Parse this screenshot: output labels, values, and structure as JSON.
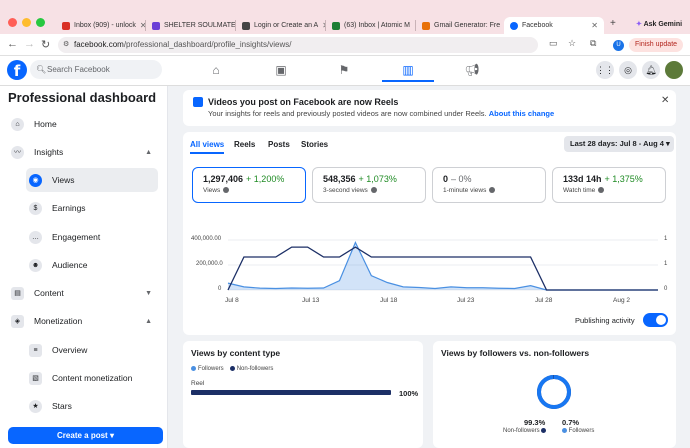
{
  "browser": {
    "tabs": [
      {
        "title": "Inbox (909) - unlock",
        "color": "#d93025"
      },
      {
        "title": "SHELTER SOULMATE",
        "color": "#6b3fd6"
      },
      {
        "title": "Login or Create an A",
        "color": "#444444"
      },
      {
        "title": "(63) Inbox | Atomic M",
        "color": "#1e7e34"
      },
      {
        "title": "Gmail Generator: Fre",
        "color": "#e8710a"
      },
      {
        "title": "Facebook",
        "color": "#0866ff"
      }
    ],
    "ask_gemini": "Ask Gemini",
    "url_host": "facebook.com",
    "url_path": "/professional_dashboard/profile_insights/views/",
    "finish_update": "Finish update",
    "profile_initial": "U"
  },
  "fb": {
    "search_placeholder": "Search Facebook",
    "logo_letter": "f"
  },
  "sidebar": {
    "title": "Professional dashboard",
    "items": [
      {
        "label": "Home",
        "icon": "home-icon"
      },
      {
        "label": "Insights",
        "icon": "insights-icon"
      },
      {
        "label": "Views",
        "icon": "eye-icon"
      },
      {
        "label": "Earnings",
        "icon": "dollar-icon"
      },
      {
        "label": "Engagement",
        "icon": "chat-icon"
      },
      {
        "label": "Audience",
        "icon": "people-icon"
      },
      {
        "label": "Content",
        "icon": "content-icon"
      },
      {
        "label": "Monetization",
        "icon": "monetization-icon"
      },
      {
        "label": "Overview",
        "icon": "overview-icon"
      },
      {
        "label": "Content monetization",
        "icon": "content-monetization-icon"
      },
      {
        "label": "Stars",
        "icon": "stars-icon"
      }
    ],
    "cta": "Create a post"
  },
  "banner": {
    "title": "Videos you post on Facebook are now Reels",
    "subtitle": "Your insights for reels and previously posted videos are now combined under Reels.",
    "link": "About this change"
  },
  "filters": [
    "All views",
    "Reels",
    "Posts",
    "Stories"
  ],
  "date_range": "Last 28 days: Jul 8 - Aug 4",
  "metrics": [
    {
      "value": "1,297,406",
      "change": "+ 1,200%",
      "label": "Views",
      "positive": true
    },
    {
      "value": "548,356",
      "change": "+ 1,073%",
      "label": "3-second views",
      "positive": true
    },
    {
      "value": "0",
      "change": "– 0%",
      "label": "1-minute views",
      "positive": false
    },
    {
      "value": "133d 14h",
      "change": "+ 1,375%",
      "label": "Watch time",
      "positive": true
    }
  ],
  "chart_data": {
    "type": "line",
    "x": [
      "Jul 8",
      "Jul 9",
      "Jul 10",
      "Jul 11",
      "Jul 12",
      "Jul 13",
      "Jul 14",
      "Jul 15",
      "Jul 16",
      "Jul 17",
      "Jul 18",
      "Jul 19",
      "Jul 20",
      "Jul 21",
      "Jul 22",
      "Jul 23",
      "Jul 24",
      "Jul 25",
      "Jul 26",
      "Jul 27",
      "Jul 28",
      "Jul 29",
      "Jul 30",
      "Jul 31",
      "Aug 1",
      "Aug 2",
      "Aug 3",
      "Aug 4"
    ],
    "x_ticks": [
      "Jul 8",
      "Jul 13",
      "Jul 18",
      "Jul 23",
      "Jul 28",
      "Aug 2"
    ],
    "y_ticks_left": [
      "400,000.00",
      "200,000.0",
      "0"
    ],
    "y_ticks_right": [
      "1",
      "1",
      "0"
    ],
    "ylim": [
      0,
      500000
    ],
    "series": [
      {
        "values": [
          55000,
          25000,
          15000,
          12000,
          16000,
          14000,
          16000,
          75000,
          380000,
          115000,
          60000,
          25000,
          20000,
          12000,
          25000,
          18000,
          18000,
          14000,
          12000,
          35000,
          0,
          0,
          0,
          0,
          0,
          0,
          0,
          0
        ],
        "fill": true,
        "color": "#4a90e2"
      },
      {
        "values": [
          0,
          1,
          1,
          1,
          1.3,
          1.3,
          1,
          1,
          1.3,
          1,
          1,
          1,
          1,
          1,
          1,
          1,
          1,
          1,
          1,
          1,
          0,
          0,
          0,
          0,
          0,
          0,
          0,
          0
        ],
        "axis": "right",
        "color": "#1c2f66"
      }
    ]
  },
  "publishing_activity": "Publishing activity",
  "by_content_type": {
    "title": "Views by content type",
    "legend": [
      "Followers",
      "Non-followers"
    ],
    "rows": [
      {
        "label": "Reel",
        "value": "100%",
        "fraction": 1.0
      }
    ]
  },
  "by_followers": {
    "title": "Views by followers vs. non-followers",
    "non_followers_pct": "99.3%",
    "non_followers_label": "Non-followers",
    "followers_pct": "0.7%",
    "followers_label": "Followers",
    "non_followers_fraction": 0.993
  },
  "colors": {
    "accent": "#0866ff",
    "followers": "#4a90e2",
    "non_followers": "#1c2f66",
    "positive": "#1f8b24"
  }
}
